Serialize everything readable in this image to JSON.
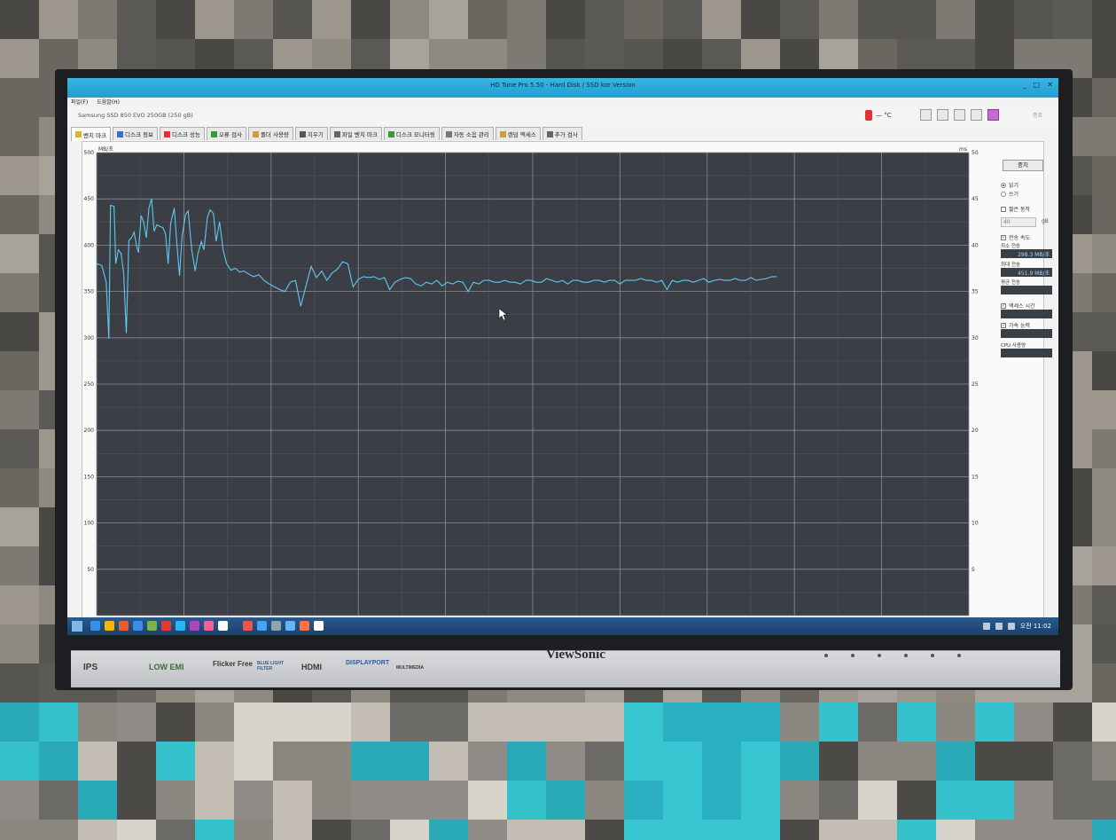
{
  "window": {
    "title": "HD Tune Pro 5.50 - Hard Disk / SSD kor Version",
    "minimize": "_",
    "maximize": "□",
    "close": "✕"
  },
  "menu": {
    "file": "파일(F)",
    "help": "도움말(H)"
  },
  "drive": {
    "selected": "Samsung SSD 850 EVO 250GB (250 gB)",
    "temperature": "— °C",
    "exit_label": "종료"
  },
  "tabs": [
    {
      "label": "벤치 마크",
      "active": true
    },
    {
      "label": "디스크 정보"
    },
    {
      "label": "디스크 성능"
    },
    {
      "label": "오류 검사"
    },
    {
      "label": "폴더 사용량"
    },
    {
      "label": "지우기"
    },
    {
      "label": "파일 벤치 마크"
    },
    {
      "label": "디스크 모니터링"
    },
    {
      "label": "자동 소음 관리"
    },
    {
      "label": "랜덤 액세스"
    },
    {
      "label": "추가 검사"
    }
  ],
  "sidebar": {
    "stop_label": "중지",
    "read_label": "읽기",
    "write_label": "쓰기",
    "read_selected": true,
    "short_stroke_label": "짧은 동작",
    "short_stroke_checked": false,
    "short_stroke_value": "40",
    "short_stroke_unit": "gB",
    "transfer_rate_label": "전송 속도",
    "transfer_rate_checked": true,
    "min_label": "최소 전송",
    "min_value": "298.3 MB/초",
    "max_label": "최대 전송",
    "max_value": "451.9 MB/초",
    "avg_label": "평균 전송",
    "avg_value": "",
    "access_label": "액세스 시간",
    "access_checked": true,
    "access_value": "",
    "burst_label": "가속 능력",
    "burst_checked": true,
    "burst_value": "",
    "cpu_label": "CPU 사용량",
    "cpu_value": ""
  },
  "chart_data": {
    "type": "line",
    "ylabel": "MB/초",
    "y2label": "ms",
    "ylim": [
      0,
      500
    ],
    "y2lim": [
      0,
      50
    ],
    "yticks": [
      50,
      100,
      150,
      200,
      250,
      300,
      350,
      400,
      450,
      500
    ],
    "y2ticks": [
      5,
      10,
      15,
      20,
      25,
      30,
      35,
      40,
      45,
      50
    ],
    "x_divisions": 10,
    "grid": true,
    "series": [
      {
        "color": "#5ec8f0",
        "x": [
          0,
          0.6,
          1.1,
          1.4,
          1.6,
          2.0,
          2.2,
          2.5,
          2.8,
          3.1,
          3.4,
          3.7,
          4.0,
          4.3,
          4.6,
          4.8,
          5.1,
          5.4,
          5.7,
          6.0,
          6.3,
          6.6,
          6.9,
          7.3,
          7.6,
          7.9,
          8.2,
          8.5,
          8.9,
          9.2,
          9.5,
          9.8,
          10.2,
          10.5,
          10.9,
          11.3,
          11.6,
          12.0,
          12.3,
          12.7,
          13.0,
          13.4,
          13.7,
          14.1,
          14.5,
          14.9,
          15.4,
          15.9,
          16.4,
          16.9,
          17.4,
          18.0,
          18.6,
          19.2,
          19.8,
          20.4,
          21.0,
          21.6,
          22.2,
          22.8,
          23.4,
          24.0,
          24.6,
          25.2,
          25.8,
          26.4,
          27.0,
          27.6,
          28.2,
          28.8,
          29.4,
          30.0,
          30.6,
          31.2,
          31.8,
          32.4,
          33.0,
          33.6,
          34.2,
          34.8,
          35.4,
          36.0,
          36.6,
          37.2,
          37.8,
          38.4,
          39.0,
          39.6,
          40.2,
          40.8,
          41.4,
          42.0,
          42.6,
          43.2,
          43.8,
          44.4,
          45.0,
          45.6,
          46.2,
          46.8,
          47.4,
          48.0,
          48.6,
          49.2,
          49.8,
          50.4,
          51.0,
          51.6,
          52.2,
          52.8,
          53.4,
          54.0,
          54.6,
          55.2,
          55.8,
          56.4,
          57.0,
          57.6,
          58.2,
          58.8,
          59.4,
          60.0,
          60.6,
          61.2,
          61.8,
          62.4,
          63.0,
          63.6,
          64.2,
          64.8,
          65.4,
          66.0,
          66.6,
          67.2,
          67.8,
          68.4,
          69.0,
          69.6,
          70.2,
          70.8,
          71.4,
          72.0,
          72.6,
          73.2,
          73.8,
          74.4,
          75.0,
          75.6,
          76.2,
          76.8,
          77.4,
          78.0
        ],
        "values": [
          380,
          378,
          360,
          299,
          443,
          442,
          380,
          395,
          391,
          370,
          305,
          405,
          408,
          414,
          398,
          392,
          432,
          425,
          408,
          440,
          450,
          415,
          422,
          420,
          419,
          412,
          380,
          424,
          440,
          402,
          367,
          410,
          433,
          437,
          395,
          372,
          390,
          404,
          395,
          430,
          438,
          434,
          404,
          425,
          395,
          380,
          373,
          375,
          371,
          372,
          369,
          366,
          368,
          362,
          358,
          355,
          352,
          350,
          360,
          362,
          334,
          356,
          377,
          365,
          372,
          362,
          370,
          374,
          382,
          380,
          355,
          363,
          366,
          365,
          366,
          363,
          365,
          352,
          360,
          363,
          365,
          364,
          358,
          356,
          360,
          358,
          362,
          356,
          360,
          358,
          361,
          360,
          350,
          360,
          358,
          362,
          362,
          360,
          360,
          362,
          360,
          360,
          358,
          362,
          362,
          360,
          360,
          364,
          362,
          360,
          362,
          358,
          362,
          362,
          360,
          360,
          362,
          362,
          360,
          362,
          362,
          358,
          362,
          362,
          362,
          364,
          362,
          362,
          360,
          362,
          352,
          362,
          360,
          362,
          362,
          360,
          362,
          364,
          360,
          362,
          363,
          362,
          362,
          364,
          362,
          362,
          365,
          362,
          363,
          364,
          366,
          366
        ]
      }
    ]
  },
  "taskbar": {
    "clock": "오전 11:02"
  },
  "monitor": {
    "brand": "ViewSonic",
    "badges": [
      "IPS",
      "LOW EMI",
      "Flicker Free",
      "BLUE LIGHT FILTER",
      "HDMI",
      "DISPLAYPORT",
      "MULTIMEDIA"
    ]
  }
}
